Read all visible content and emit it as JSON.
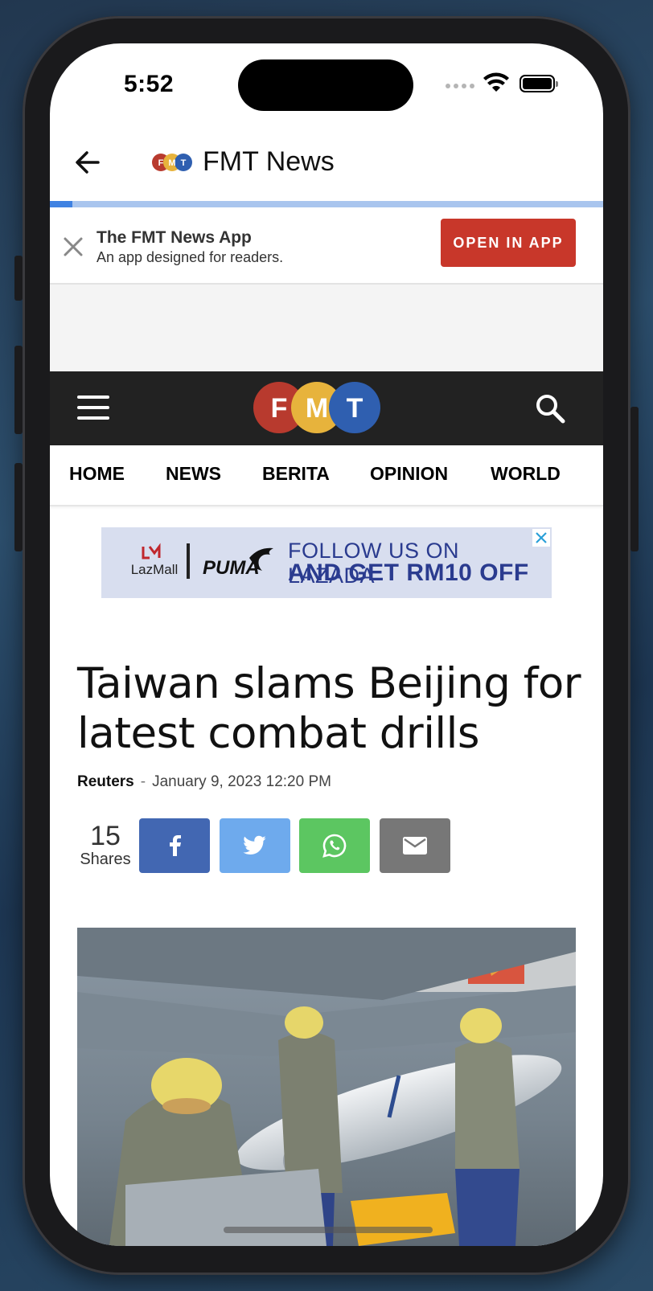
{
  "status_bar": {
    "time": "5:52"
  },
  "app_bar": {
    "title": "FMT News",
    "logo_letters": [
      "F",
      "M",
      "T"
    ]
  },
  "page_load": {
    "progress_fraction": 0.04
  },
  "app_banner": {
    "title": "The FMT News App",
    "subtitle": "An app designed for readers.",
    "button_label": "OPEN IN APP"
  },
  "site_header": {
    "logo_letters": [
      "F",
      "M",
      "T"
    ]
  },
  "nav": {
    "items": [
      "HOME",
      "NEWS",
      "BERITA",
      "OPINION",
      "WORLD"
    ]
  },
  "ad": {
    "brand_lazmall": "LazMall",
    "brand_puma": "PUMA",
    "line1": "FOLLOW US ON LAZADA",
    "line2": "AND GET RM10 OFF"
  },
  "article": {
    "headline": "Taiwan slams Beijing for latest combat drills",
    "author": "Reuters",
    "separator": "-",
    "date": "January 9, 2023 12:20 PM",
    "shares_count": "15",
    "shares_label": "Shares"
  },
  "share_buttons": [
    {
      "name": "facebook",
      "color": "#4267b2",
      "icon": "facebook-icon"
    },
    {
      "name": "twitter",
      "color": "#6eaaed",
      "icon": "twitter-icon"
    },
    {
      "name": "whatsapp",
      "color": "#5cc661",
      "icon": "whatsapp-icon"
    },
    {
      "name": "email",
      "color": "#777777",
      "icon": "mail-icon"
    }
  ],
  "colors": {
    "open_app_button": "#c8372a",
    "header_background": "#222222",
    "logo_red": "#b83a2e",
    "logo_yellow": "#e7b33c",
    "logo_blue": "#2f5fb0",
    "progress": "#3f82e2"
  }
}
